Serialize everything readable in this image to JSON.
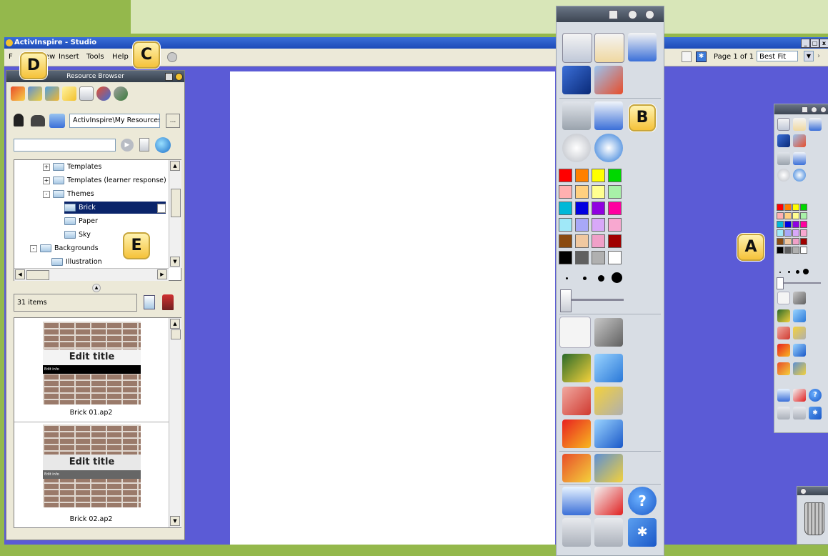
{
  "window": {
    "title": "ActivInspire - Studio",
    "controls": [
      "_",
      "□",
      "x"
    ]
  },
  "menu": {
    "items": [
      "F",
      "ew",
      "Insert",
      "Tools",
      "Help"
    ]
  },
  "page_controls": {
    "page_label": "Page 1 of 1",
    "zoom_value": "Best Fit"
  },
  "resource_browser": {
    "title": "Resource Browser",
    "path_value": "ActivInspire\\My Resources",
    "browse_label": "...",
    "search_value": "",
    "tree": [
      {
        "label": "Templates",
        "level": 2,
        "expander": "+"
      },
      {
        "label": "Templates (learner response)",
        "level": 2,
        "expander": "+"
      },
      {
        "label": "Themes",
        "level": 2,
        "expander": "-"
      },
      {
        "label": "Brick",
        "level": 3,
        "selected": true
      },
      {
        "label": "Paper",
        "level": 3
      },
      {
        "label": "Sky",
        "level": 3
      },
      {
        "label": "Backgrounds",
        "level": 1,
        "expander": "-"
      },
      {
        "label": "Illustration",
        "level": 2
      }
    ],
    "count_label": "31 items",
    "thumbnails": [
      {
        "caption": "Brick 01.ap2",
        "title_text": "Edit title",
        "sub_text": "Edit info"
      },
      {
        "caption": "Brick 02.ap2",
        "title_text": "Edit title",
        "sub_text": "Edit info"
      }
    ]
  },
  "badges": {
    "a": "A",
    "b": "B",
    "c": "C",
    "d": "D",
    "e": "E"
  },
  "palette": [
    [
      "#ff0000",
      "#ff8000",
      "#ffff00",
      "#00d800"
    ],
    [
      "#ffb0b0",
      "#ffd080",
      "#ffff90",
      "#a8f0a8"
    ],
    [
      "#00b8d8",
      "#0000e0",
      "#9000e0",
      "#ff00a0"
    ],
    [
      "#a0e8f8",
      "#a8a8f8",
      "#d8a8f8",
      "#f8a8d0"
    ],
    [
      "#8a4a10",
      "#f0c8a0",
      "#f0a0c8",
      "#a00000"
    ],
    [
      "#000000",
      "#606060",
      "#b0b0b0",
      "#ffffff"
    ]
  ]
}
